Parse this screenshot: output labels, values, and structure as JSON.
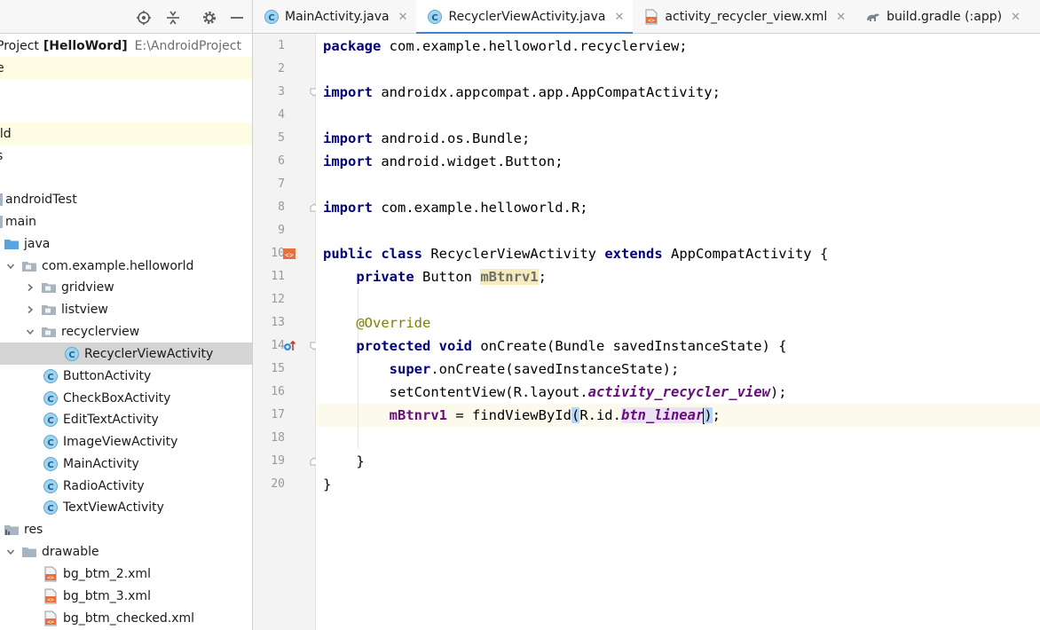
{
  "project_panel": {
    "header": {
      "project_label": "Project",
      "project_name": "[HelloWord]",
      "project_path": "E:\\AndroidProject"
    },
    "tree": [
      {
        "text": "e",
        "icon": "",
        "chevron": "",
        "highlight": true
      },
      {
        "text": "",
        "icon": "",
        "chevron": ""
      },
      {
        "text": "ild",
        "icon": "",
        "chevron": "",
        "highlight": true
      },
      {
        "text": "s",
        "icon": "",
        "chevron": ""
      },
      {
        "text": ":",
        "icon": "",
        "chevron": ""
      },
      {
        "text": "androidTest",
        "icon": "",
        "chevron": ""
      },
      {
        "text": "main",
        "icon": "",
        "chevron": ""
      },
      {
        "text": "java",
        "icon": "folder-blue-icon",
        "chevron": ""
      },
      {
        "text": "com.example.helloworld",
        "icon": "package-icon",
        "chevron": "down"
      },
      {
        "text": "gridview",
        "icon": "package-icon",
        "chevron": "right"
      },
      {
        "text": "listview",
        "icon": "package-icon",
        "chevron": "right"
      },
      {
        "text": "recyclerview",
        "icon": "package-icon",
        "chevron": "down"
      },
      {
        "text": "RecyclerViewActivity",
        "icon": "class-icon",
        "chevron": "",
        "selected": true
      },
      {
        "text": "ButtonActivity",
        "icon": "class-icon",
        "chevron": ""
      },
      {
        "text": "CheckBoxActivity",
        "icon": "class-icon",
        "chevron": ""
      },
      {
        "text": "EditTextActivity",
        "icon": "class-icon",
        "chevron": ""
      },
      {
        "text": "ImageViewActivity",
        "icon": "class-icon",
        "chevron": ""
      },
      {
        "text": "MainActivity",
        "icon": "class-icon",
        "chevron": ""
      },
      {
        "text": "RadioActivity",
        "icon": "class-icon",
        "chevron": ""
      },
      {
        "text": "TextViewActivity",
        "icon": "class-icon",
        "chevron": ""
      },
      {
        "text": "res",
        "icon": "res-folder-icon",
        "chevron": ""
      },
      {
        "text": "drawable",
        "icon": "folder-gray-icon",
        "chevron": "down"
      },
      {
        "text": "bg_btm_2.xml",
        "icon": "xml-icon",
        "chevron": ""
      },
      {
        "text": "bg_btm_3.xml",
        "icon": "xml-icon",
        "chevron": ""
      },
      {
        "text": "bg_btm_checked.xml",
        "icon": "xml-icon",
        "chevron": ""
      }
    ]
  },
  "toolbar": {
    "icons": [
      "locate-icon",
      "collapse-all-icon",
      "gear-icon",
      "minimize-icon"
    ]
  },
  "tabs": [
    {
      "label": "MainActivity.java",
      "icon": "class-icon",
      "active": false
    },
    {
      "label": "RecyclerViewActivity.java",
      "icon": "class-icon",
      "active": true
    },
    {
      "label": "activity_recycler_view.xml",
      "icon": "xml-icon",
      "active": false
    },
    {
      "label": "build.gradle (:app)",
      "icon": "gradle-icon",
      "active": false
    }
  ],
  "tab_close_glyph": "✕",
  "editor": {
    "line_numbers": [
      "1",
      "2",
      "3",
      "4",
      "5",
      "6",
      "7",
      "8",
      "9",
      "10",
      "11",
      "12",
      "13",
      "14",
      "15",
      "16",
      "17",
      "18",
      "19",
      "20"
    ],
    "caret_line": "17",
    "lines": [
      [
        {
          "t": "package",
          "c": "kw"
        },
        {
          "t": " com.example.helloworld.recyclerview;"
        }
      ],
      [],
      [
        {
          "t": "import",
          "c": "kw"
        },
        {
          "t": " androidx.appcompat.app.AppCompatActivity;"
        }
      ],
      [],
      [
        {
          "t": "import",
          "c": "kw"
        },
        {
          "t": " android.os.Bundle;"
        }
      ],
      [
        {
          "t": "import",
          "c": "kw"
        },
        {
          "t": " android.widget.Button;"
        }
      ],
      [],
      [
        {
          "t": "import",
          "c": "kw"
        },
        {
          "t": " com.example.helloworld.R;"
        }
      ],
      [],
      [
        {
          "t": "public",
          "c": "kw"
        },
        {
          "t": " "
        },
        {
          "t": "class",
          "c": "kw"
        },
        {
          "t": " RecyclerViewActivity "
        },
        {
          "t": "extends",
          "c": "kw"
        },
        {
          "t": " AppCompatActivity {"
        }
      ],
      [
        {
          "t": "    "
        },
        {
          "t": "private",
          "c": "kw"
        },
        {
          "t": " Button "
        },
        {
          "t": "mBtnrv1",
          "c": "fld unused"
        },
        {
          "t": ";"
        }
      ],
      [],
      [
        {
          "t": "    "
        },
        {
          "t": "@Override",
          "c": "ann"
        }
      ],
      [
        {
          "t": "    "
        },
        {
          "t": "protected",
          "c": "kw"
        },
        {
          "t": " "
        },
        {
          "t": "void",
          "c": "kw"
        },
        {
          "t": " onCreate(Bundle savedInstanceState) {"
        }
      ],
      [
        {
          "t": "        "
        },
        {
          "t": "super",
          "c": "kw"
        },
        {
          "t": ".onCreate(savedInstanceState);"
        }
      ],
      [
        {
          "t": "        setContentView(R.layout."
        },
        {
          "t": "activity_recycler_view",
          "c": "st"
        },
        {
          "t": ");"
        }
      ],
      [
        {
          "t": "        "
        },
        {
          "t": "mBtnrv1",
          "c": "fld"
        },
        {
          "t": " = findViewById"
        },
        {
          "t": "(",
          "c": "brace-hl"
        },
        {
          "t": "R.id."
        },
        {
          "t": "btn_linear",
          "c": "st id-hl"
        },
        {
          "t": "CARET"
        },
        {
          "t": ")",
          "c": "brace-hl"
        },
        {
          "t": ";"
        }
      ],
      [],
      [
        {
          "t": "    }"
        }
      ],
      [
        {
          "t": "}"
        }
      ]
    ]
  },
  "colors": {
    "keyword": "#000080",
    "annotation": "#808000",
    "field": "#660e7a",
    "caret_line": "#fcfaed",
    "selection_tree": "#d4d4d4",
    "tab_underline": "#4083c9"
  }
}
